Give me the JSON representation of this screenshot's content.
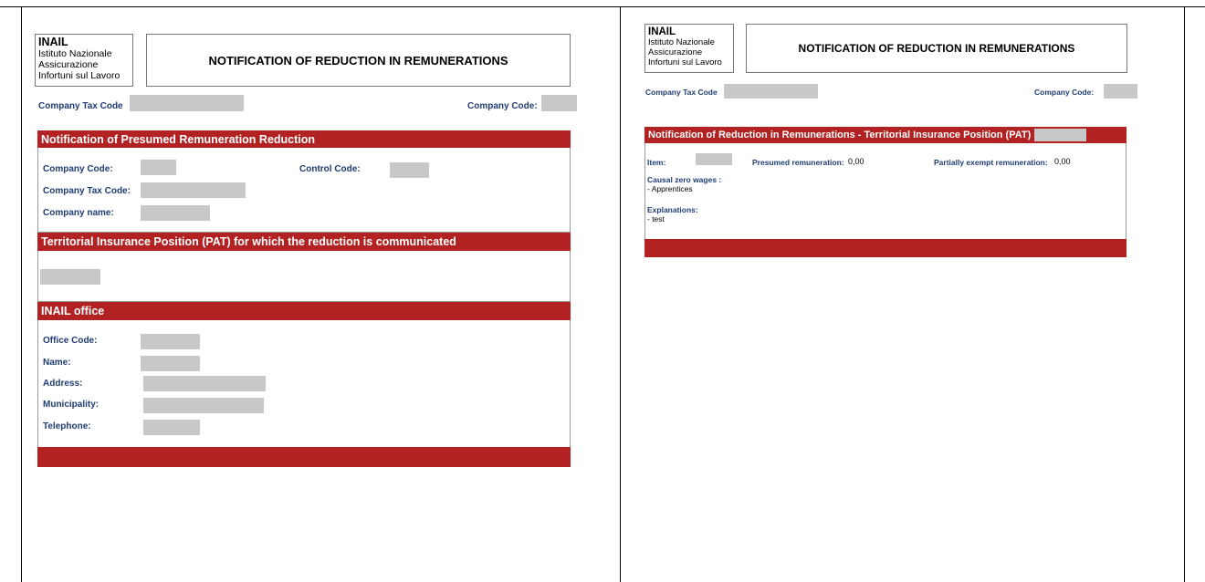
{
  "left_page": {
    "logo": {
      "brand": "INAIL",
      "line1": "Istituto Nazionale",
      "line2": "Assicurazione",
      "line3": "Infortuni sul Lavoro"
    },
    "title": "NOTIFICATION OF REDUCTION IN REMUNERATIONS",
    "company_tax_code_label": "Company Tax Code",
    "company_code_label": "Company Code:",
    "section1": {
      "heading": "Notification of Presumed Remuneration Reduction",
      "company_code_label": "Company Code:",
      "control_code_label": "Control Code:",
      "company_tax_code_label": "Company Tax Code:",
      "company_name_label": "Company name:"
    },
    "section2": {
      "heading": "Territorial Insurance Position (PAT) for which the reduction is communicated"
    },
    "section3": {
      "heading": "INAIL office",
      "office_code_label": "Office Code:",
      "name_label": "Name:",
      "address_label": "Address:",
      "municipality_label": "Municipality:",
      "telephone_label": "Telephone:"
    }
  },
  "right_page": {
    "logo": {
      "brand": "INAIL",
      "line1": "Istituto Nazionale",
      "line2": "Assicurazione",
      "line3": "Infortuni sul Lavoro"
    },
    "title": "NOTIFICATION OF REDUCTION IN REMUNERATIONS",
    "company_tax_code_label": "Company Tax Code",
    "company_code_label": "Company Code:",
    "section": {
      "heading": "Notification of Reduction in Remunerations - Territorial Insurance Position (PAT)",
      "item_label": "Item:",
      "presumed_label": "Presumed remuneration:",
      "presumed_value": "0,00",
      "partially_label": "Partially exempt remuneration:",
      "partially_value": "0,00",
      "causal_label": "Causal zero wages :",
      "causal_value": "- Apprentices",
      "explanations_label": "Explanations:",
      "explanations_value": "- test"
    }
  }
}
